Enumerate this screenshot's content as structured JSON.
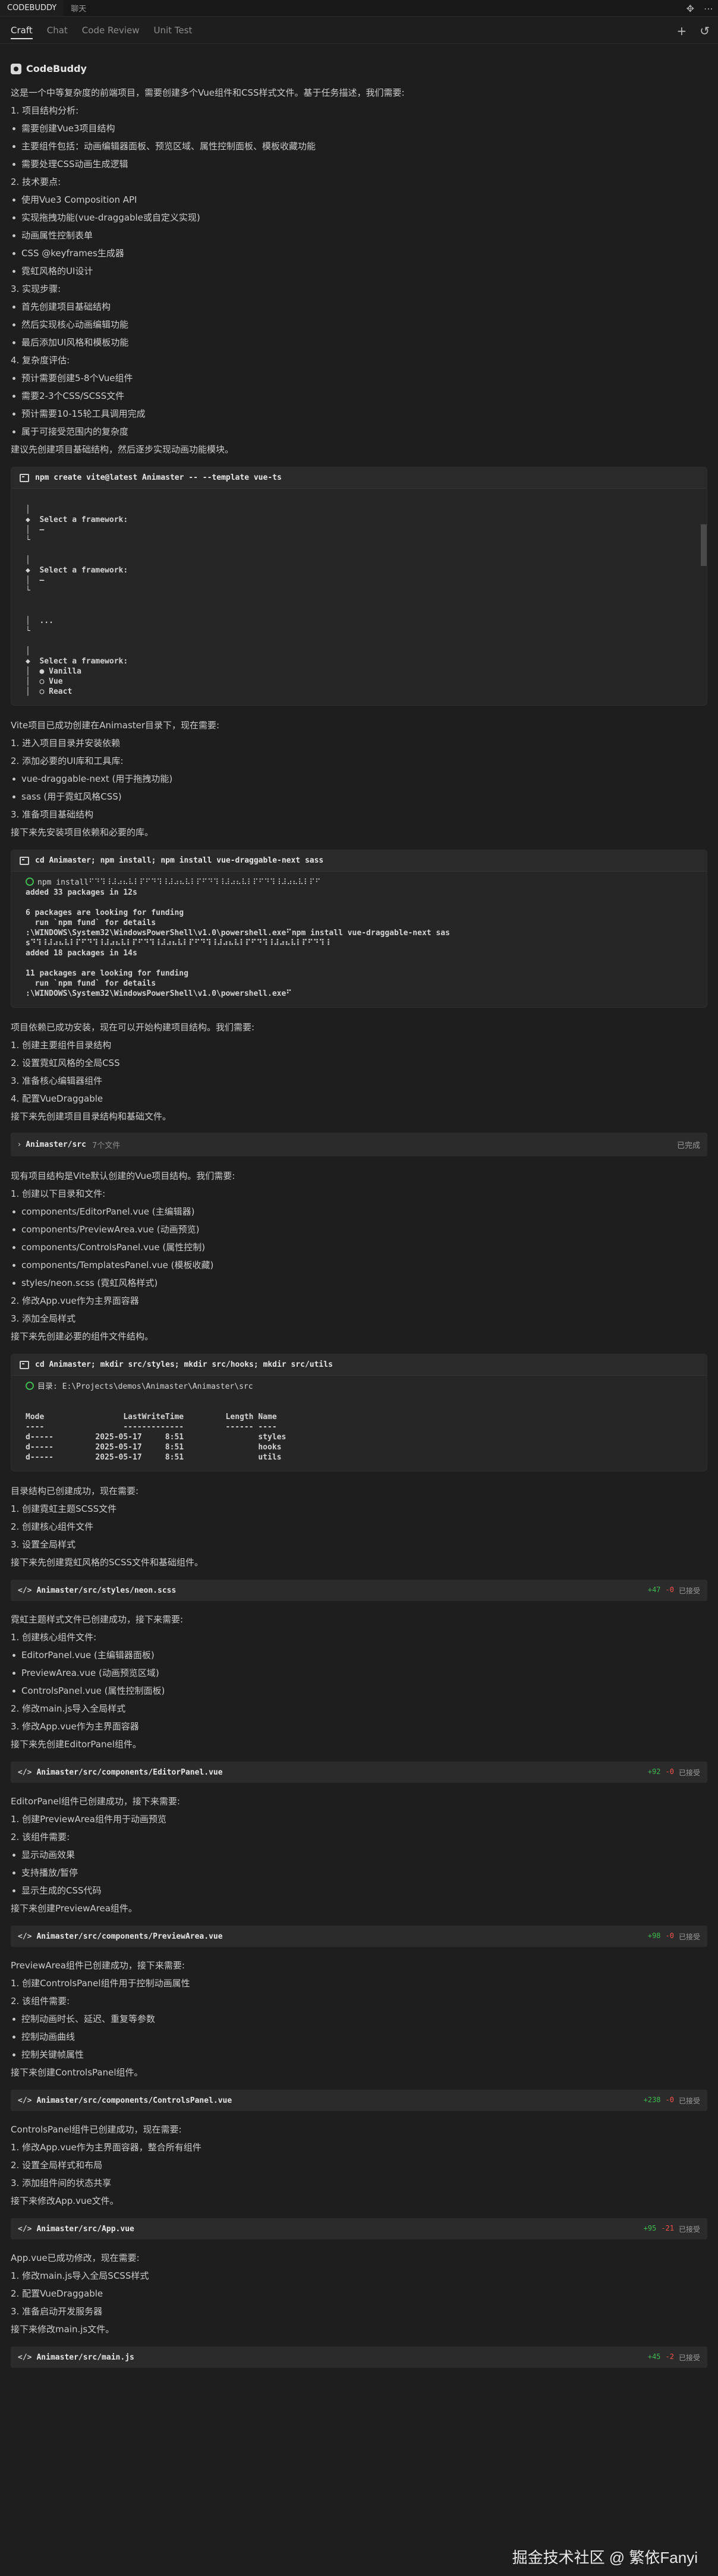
{
  "titlebar": {
    "tabs": [
      "CODEBUDDY",
      "聊天"
    ],
    "icons": [
      "move-icon",
      "more-icon"
    ]
  },
  "nav": {
    "tabs": [
      "Craft",
      "Chat",
      "Code Review",
      "Unit Test"
    ],
    "active": "Craft",
    "icons": [
      "plus-icon",
      "history-icon"
    ]
  },
  "assistant": {
    "name": "CodeBuddy"
  },
  "section1": {
    "intro": "这是一个中等复杂度的前端项目，需要创建多个Vue组件和CSS样式文件。基于任务描述，我们需要:",
    "items": [
      {
        "t": "num",
        "v": "1. 项目结构分析:"
      },
      {
        "t": "bul",
        "v": "需要创建Vue3项目结构"
      },
      {
        "t": "bul",
        "v": "主要组件包括：动画编辑器面板、预览区域、属性控制面板、模板收藏功能"
      },
      {
        "t": "bul",
        "v": "需要处理CSS动画生成逻辑"
      },
      {
        "t": "num",
        "v": "2. 技术要点:"
      },
      {
        "t": "bul",
        "v": "使用Vue3 Composition API"
      },
      {
        "t": "bul",
        "v": "实现拖拽功能(vue-draggable或自定义实现)"
      },
      {
        "t": "bul",
        "v": "动画属性控制表单"
      },
      {
        "t": "bul",
        "v": "CSS @keyframes生成器"
      },
      {
        "t": "bul",
        "v": "霓虹风格的UI设计"
      },
      {
        "t": "num",
        "v": "3. 实现步骤:"
      },
      {
        "t": "bul",
        "v": "首先创建项目基础结构"
      },
      {
        "t": "bul",
        "v": "然后实现核心动画编辑功能"
      },
      {
        "t": "bul",
        "v": "最后添加UI风格和模板功能"
      },
      {
        "t": "num",
        "v": "4. 复杂度评估:"
      },
      {
        "t": "bul",
        "v": "预计需要创建5-8个Vue组件"
      },
      {
        "t": "bul",
        "v": "需要2-3个CSS/SCSS文件"
      },
      {
        "t": "bul",
        "v": "预计需要10-15轮工具调用完成"
      },
      {
        "t": "bul",
        "v": "属于可接受范围内的复杂度"
      }
    ],
    "outro": "建议先创建项目基础结构，然后逐步实现动画功能模块。"
  },
  "term1": {
    "command": "npm create vite@latest Animaster -- --template vue-ts",
    "lines": [
      "",
      "│",
      "◆  Select a framework:",
      "│  —",
      "└",
      "",
      "│",
      "◆  Select a framework:",
      "│  —",
      "└",
      "",
      "",
      "│  ...",
      "└",
      "",
      "│",
      "◆  Select a framework:",
      "│  ● Vanilla",
      "│  ○ Vue",
      "│  ○ React"
    ]
  },
  "section2": {
    "intro": "Vite项目已成功创建在Animaster目录下，现在需要:",
    "items": [
      {
        "t": "num",
        "v": "1. 进入项目目录并安装依赖"
      },
      {
        "t": "num",
        "v": "2. 添加必要的UI库和工具库:"
      },
      {
        "t": "bul",
        "v": "vue-draggable-next (用于拖拽功能)"
      },
      {
        "t": "bul",
        "v": "sass (用于霓虹风格CSS)"
      },
      {
        "t": "num",
        "v": "3. 准备项目基础结构"
      }
    ],
    "outro": "接下来先安装项目依赖和必要的库。"
  },
  "term2": {
    "command": "cd Animaster; npm install; npm install vue-draggable-next sass",
    "lines": [
      "npm install⠋⠙⠹⠸⠼⠴⠦⠧⠇⠏⠋⠙⠹⠸⠼⠴⠦⠧⠇⠏⠋⠙⠹⠸⠼⠴⠦⠧⠇⠏⠋⠙⠹⠸⠼⠴⠦⠧⠇⠏⠋",
      "added 33 packages in 12s",
      "",
      "6 packages are looking for funding",
      "  run `npm fund` for details",
      ":\\WINDOWS\\System32\\WindowsPowerShell\\v1.0\\powershell.exe⠋npm install vue-draggable-next sas",
      "s⠙⠹⠸⠼⠴⠦⠧⠇⠏⠋⠙⠹⠸⠼⠴⠦⠧⠇⠏⠋⠙⠹⠸⠼⠴⠦⠧⠇⠏⠋⠙⠹⠸⠼⠴⠦⠧⠇⠏⠋⠙⠹⠸⠼⠴⠦⠧⠇⠏⠋⠙⠹⠸",
      "added 18 packages in 14s",
      "",
      "11 packages are looking for funding",
      "  run `npm fund` for details",
      ":\\WINDOWS\\System32\\WindowsPowerShell\\v1.0\\powershell.exe⠋"
    ]
  },
  "section3": {
    "intro": "项目依赖已成功安装，现在可以开始构建项目结构。我们需要:",
    "items": [
      {
        "t": "num",
        "v": "1. 创建主要组件目录结构"
      },
      {
        "t": "num",
        "v": "2. 设置霓虹风格的全局CSS"
      },
      {
        "t": "num",
        "v": "3. 准备核心编辑器组件"
      },
      {
        "t": "num",
        "v": "4. 配置VueDraggable"
      }
    ],
    "outro": "接下来先创建项目目录结构和基础文件。"
  },
  "folder": {
    "name": "Animaster/src",
    "count": "7个文件",
    "status": "已完成"
  },
  "section4": {
    "intro": "现有项目结构是Vite默认创建的Vue项目结构。我们需要:",
    "items": [
      {
        "t": "num",
        "v": "1. 创建以下目录和文件:"
      },
      {
        "t": "bul",
        "v": "components/EditorPanel.vue (主编辑器)"
      },
      {
        "t": "bul",
        "v": "components/PreviewArea.vue (动画预览)"
      },
      {
        "t": "bul",
        "v": "components/ControlsPanel.vue (属性控制)"
      },
      {
        "t": "bul",
        "v": "components/TemplatesPanel.vue (模板收藏)"
      },
      {
        "t": "bul",
        "v": "styles/neon.scss (霓虹风格样式)"
      },
      {
        "t": "num",
        "v": "2. 修改App.vue作为主界面容器"
      },
      {
        "t": "num",
        "v": "3. 添加全局样式"
      }
    ],
    "outro": "接下来先创建必要的组件文件结构。"
  },
  "term3": {
    "command": "cd Animaster; mkdir src/styles; mkdir src/hooks; mkdir src/utils",
    "lines": [
      "目录: E:\\Projects\\demos\\Animaster\\Animaster\\src",
      "",
      "",
      "Mode                 LastWriteTime         Length Name",
      "----                 -------------         ------ ----",
      "d-----         2025-05-17     8:51                styles",
      "d-----         2025-05-17     8:51                hooks",
      "d-----         2025-05-17     8:51                utils"
    ]
  },
  "section5": {
    "intro": "目录结构已创建成功，现在需要:",
    "items": [
      {
        "t": "num",
        "v": "1. 创建霓虹主题SCSS文件"
      },
      {
        "t": "num",
        "v": "2. 创建核心组件文件"
      },
      {
        "t": "num",
        "v": "3. 设置全局样式"
      }
    ],
    "outro": "接下来先创建霓虹风格的SCSS文件和基础组件。"
  },
  "file1": {
    "path": "Animaster/src/styles/neon.scss",
    "plus": "+47",
    "minus": "-0",
    "status": "已接受"
  },
  "section6": {
    "intro": "霓虹主题样式文件已创建成功，接下来需要:",
    "items": [
      {
        "t": "num",
        "v": "1. 创建核心组件文件:"
      },
      {
        "t": "bul",
        "v": "EditorPanel.vue (主编辑器面板)"
      },
      {
        "t": "bul",
        "v": "PreviewArea.vue (动画预览区域)"
      },
      {
        "t": "bul",
        "v": "ControlsPanel.vue (属性控制面板)"
      },
      {
        "t": "num",
        "v": "2. 修改main.js导入全局样式"
      },
      {
        "t": "num",
        "v": "3. 修改App.vue作为主界面容器"
      }
    ],
    "outro": "接下来先创建EditorPanel组件。"
  },
  "file2": {
    "path": "Animaster/src/components/EditorPanel.vue",
    "plus": "+92",
    "minus": "-0",
    "status": "已接受"
  },
  "section7": {
    "intro": "EditorPanel组件已创建成功，接下来需要:",
    "items": [
      {
        "t": "num",
        "v": "1. 创建PreviewArea组件用于动画预览"
      },
      {
        "t": "num",
        "v": "2. 该组件需要:"
      },
      {
        "t": "bul",
        "v": "显示动画效果"
      },
      {
        "t": "bul",
        "v": "支持播放/暂停"
      },
      {
        "t": "bul",
        "v": "显示生成的CSS代码"
      }
    ],
    "outro": "接下来创建PreviewArea组件。"
  },
  "file3": {
    "path": "Animaster/src/components/PreviewArea.vue",
    "plus": "+98",
    "minus": "-0",
    "status": "已接受"
  },
  "section8": {
    "intro": "PreviewArea组件已创建成功，接下来需要:",
    "items": [
      {
        "t": "num",
        "v": "1. 创建ControlsPanel组件用于控制动画属性"
      },
      {
        "t": "num",
        "v": "2. 该组件需要:"
      },
      {
        "t": "bul",
        "v": "控制动画时长、延迟、重复等参数"
      },
      {
        "t": "bul",
        "v": "控制动画曲线"
      },
      {
        "t": "bul",
        "v": "控制关键帧属性"
      }
    ],
    "outro": "接下来创建ControlsPanel组件。"
  },
  "file4": {
    "path": "Animaster/src/components/ControlsPanel.vue",
    "plus": "+238",
    "minus": "-0",
    "status": "已接受"
  },
  "section9": {
    "intro": "ControlsPanel组件已创建成功，现在需要:",
    "items": [
      {
        "t": "num",
        "v": "1. 修改App.vue作为主界面容器，整合所有组件"
      },
      {
        "t": "num",
        "v": "2. 设置全局样式和布局"
      },
      {
        "t": "num",
        "v": "3. 添加组件间的状态共享"
      }
    ],
    "outro": "接下来修改App.vue文件。"
  },
  "file5": {
    "path": "Animaster/src/App.vue",
    "plus": "+95",
    "minus": "-21",
    "status": "已接受"
  },
  "section10": {
    "intro": "App.vue已成功修改，现在需要:",
    "items": [
      {
        "t": "num",
        "v": "1. 修改main.js导入全局SCSS样式"
      },
      {
        "t": "num",
        "v": "2. 配置VueDraggable"
      },
      {
        "t": "num",
        "v": "3. 准备启动开发服务器"
      }
    ],
    "outro": "接下来修改main.js文件。"
  },
  "file6": {
    "path": "Animaster/src/main.js",
    "plus": "+45",
    "minus": "-2",
    "status": "已接受"
  },
  "watermark": "掘金技术社区 @ 繁依Fanyi"
}
